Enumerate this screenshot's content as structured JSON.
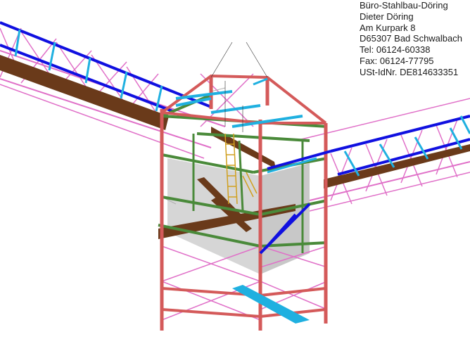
{
  "titleblock": {
    "company": "Büro-Stahlbau-Döring",
    "name": "Dieter Döring",
    "street": "Am Kurpark 8",
    "city": "D65307 Bad Schwalbach",
    "phone": "Tel: 06124-60338",
    "fax": "Fax: 06124-77795",
    "vat": "USt-IdNr. DE814633351"
  },
  "colors": {
    "background": "#ffffff",
    "column_red": "#d45a5a",
    "chord_blue": "#1010e0",
    "diagonal_cyan": "#1fb0e0",
    "truss_pink": "#e070c8",
    "walkway_brown": "#6a3a1a",
    "beam_green": "#4a8a3a",
    "ladder_yellow": "#d0a020",
    "panel_gray": "#d6d6d6"
  }
}
